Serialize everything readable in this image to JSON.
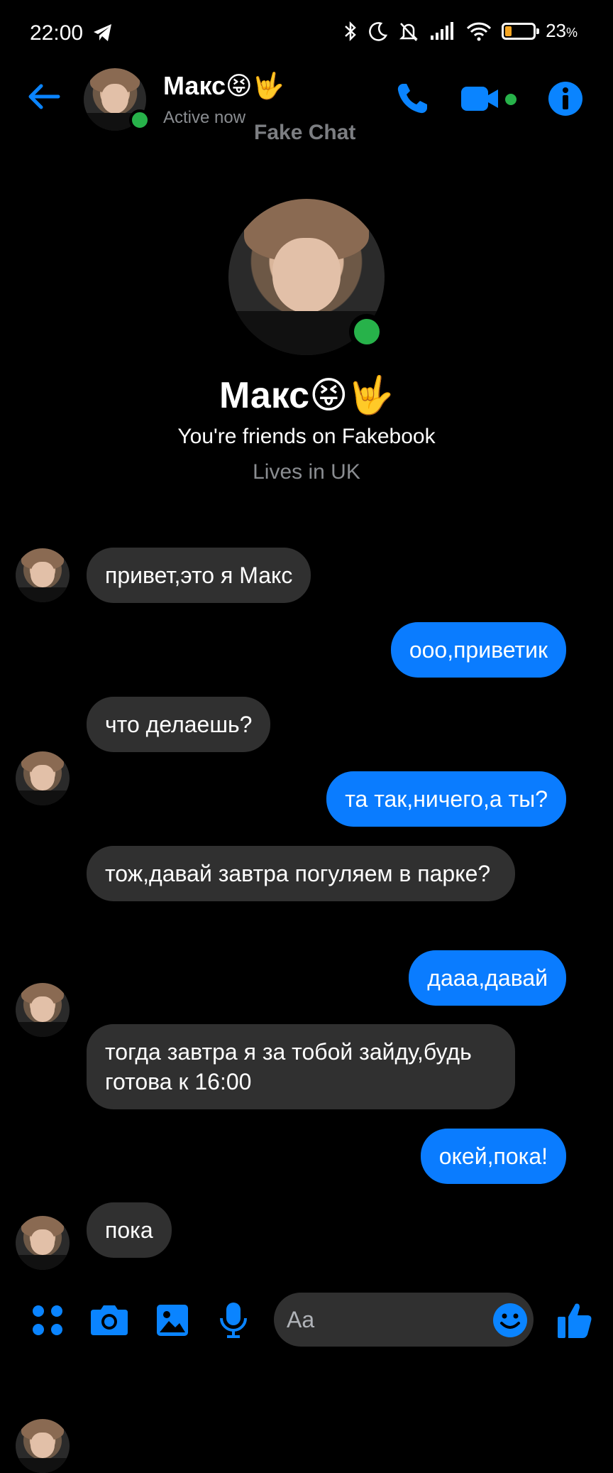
{
  "status_bar": {
    "time": "22:00",
    "battery_percent": "23",
    "battery_symbol": "%",
    "battery_level": 0.23,
    "icons": [
      "telegram-icon",
      "bluetooth-icon",
      "moon-icon",
      "bell-off-icon",
      "signal-icon",
      "wifi-icon",
      "battery-icon"
    ]
  },
  "header": {
    "name": "Макс😝🤟",
    "status": "Active now",
    "watermark": "Fake Chat"
  },
  "profile": {
    "name": "Макс😝🤟",
    "friends_text": "You're friends on Fakebook",
    "lives_text": "Lives in UK"
  },
  "messages": [
    {
      "direction": "in",
      "text": "привет,это я Макс"
    },
    {
      "direction": "out",
      "text": "ооо,приветик"
    },
    {
      "direction": "in",
      "text": "что делаешь?"
    },
    {
      "direction": "out",
      "text": "та так,ничего,а ты?"
    },
    {
      "direction": "in",
      "text": "тож,давай завтра погуляем в парке?"
    },
    {
      "direction": "out",
      "text": "дааа,давай"
    },
    {
      "direction": "in",
      "text": "тогда завтра я за тобой зайду,будь готова к 16:00"
    },
    {
      "direction": "out",
      "text": "окей,пока!"
    },
    {
      "direction": "in",
      "text": "пока"
    }
  ],
  "composer": {
    "placeholder": "Aa"
  },
  "colors": {
    "accent": "#0a84ff",
    "outgoing_bubble": "#0a7cff",
    "incoming_bubble": "#303030",
    "online": "#27b24a",
    "background": "#000000"
  }
}
